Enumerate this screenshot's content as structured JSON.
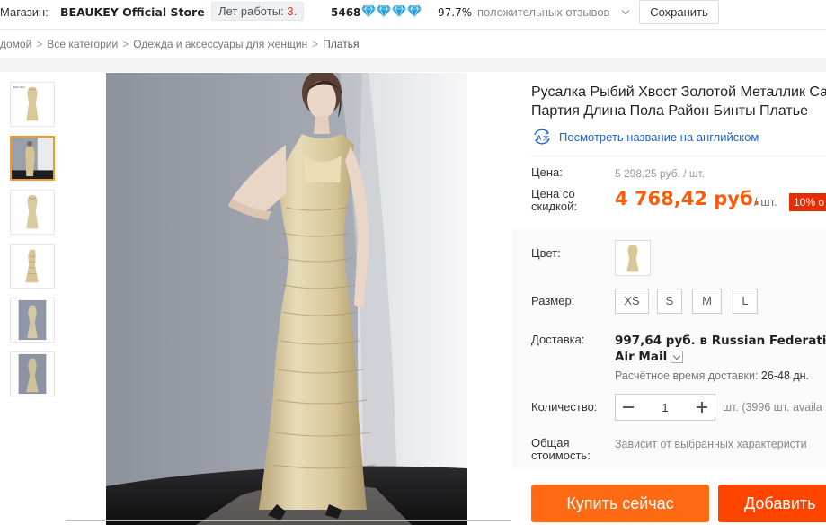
{
  "store": {
    "label": "Магазин:",
    "name": "BEAUKEY Official Store",
    "years_label": "Лет работы:",
    "years_value": "3",
    "score": "5468",
    "gems": [
      "diamond-icon",
      "diamond-icon",
      "diamond-icon",
      "diamond-icon"
    ],
    "positive_percent": "97.7%",
    "positive_label": "положительных отзывов",
    "save_label": "Сохранить"
  },
  "breadcrumb": {
    "items": [
      "домой",
      "Все категории",
      "Одежда и аксессуары для женщин",
      "Платья"
    ],
    "separator": ">"
  },
  "gallery": {
    "thumb_count": 6,
    "active_index": 1
  },
  "product": {
    "title_line1": "Русалка Рыбий Хвост Золотой Металлик Са",
    "title_line2": "Партия Длина Пола Район Бинты Платье",
    "translate_label": "Посмотреть название на английском",
    "price_label": "Цена:",
    "old_price": "5 298,25 руб. / шт.",
    "discount_label": "Цена со скидкой:",
    "discount_price": "4 768,42 руб.",
    "per_unit": "/ шт.",
    "discount_badge": "10% о",
    "color_label": "Цвет:",
    "size_label": "Размер:",
    "sizes": [
      "XS",
      "S",
      "M",
      "L"
    ],
    "shipping_label": "Доставка:",
    "shipping_cost": "997,64 руб.",
    "shipping_in": "в Russian Federatio",
    "shipping_method": "Air Mail",
    "delivery_est_label": "Расчётное время доставки:",
    "delivery_est_value": "26-48 дн.",
    "quantity_label": "Количество:",
    "quantity_value": "1",
    "availability": "шт. (3996 шт. availa",
    "total_label": "Общая стоимость:",
    "total_value": "Зависит от выбранных характеристи",
    "buy_label": "Купить сейчас",
    "cart_label": "Добавить"
  },
  "colors": {
    "accent_orange": "#ff6a14",
    "price_orange": "#ff5c0a",
    "link_blue": "#1e61c9",
    "badge_red": "#e62e04",
    "active_thumb_border": "#f59a1b",
    "gem_blue": "#2a9fd6"
  }
}
